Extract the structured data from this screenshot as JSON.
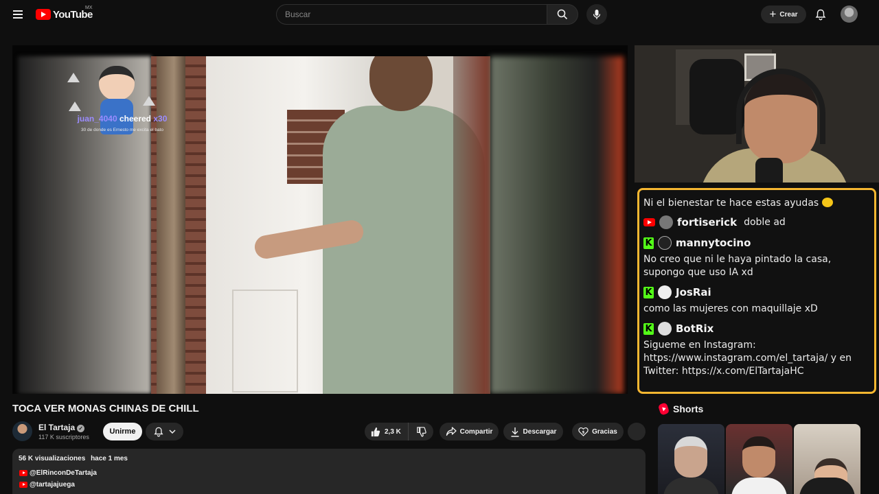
{
  "header": {
    "logo_text": "YouTube",
    "region": "MX",
    "search_placeholder": "Buscar",
    "create_label": "Crear"
  },
  "player": {
    "alert": {
      "user": "juan_4040",
      "action": "cheered",
      "amount": "x30",
      "message": "30 de donde es Ernesto me excita el bato"
    }
  },
  "chat": {
    "messages": [
      {
        "text": "Ni el bienestar te hace estas ayudas"
      },
      {
        "platform": "youtube",
        "user": "fortiserick",
        "text": "doble ad"
      },
      {
        "platform": "kick",
        "user": "mannytocino",
        "text": "No creo que ni le haya pintado la casa, supongo que uso IA xd"
      },
      {
        "platform": "kick",
        "user": "JosRai",
        "text": "como las mujeres con maquillaje xD"
      },
      {
        "platform": "kick",
        "user": "BotRix",
        "text": "Sigueme en Instagram: https://www.instagram.com/el_tartaja/ y en Twitter: https://x.com/ElTartajaHC"
      }
    ]
  },
  "video": {
    "title": "TOCA VER MONAS CHINAS DE CHILL"
  },
  "channel": {
    "name": "El Tartaja",
    "subscribers": "117 K suscriptores",
    "join_label": "Unirme"
  },
  "actions": {
    "likes": "2,3 K",
    "share": "Compartir",
    "download": "Descargar",
    "thanks": "Gracias"
  },
  "description": {
    "views": "56 K visualizaciones",
    "date": "hace 1 mes",
    "links": [
      "@ElRinconDeTartaja",
      "@tartajajuega"
    ]
  },
  "shorts": {
    "title": "Shorts"
  },
  "colors": {
    "background": "#0f0f0f",
    "chat_border": "#f7b731",
    "kick_green": "#53fc18",
    "youtube_red": "#ff0000",
    "alert_name": "#9b8cff"
  }
}
